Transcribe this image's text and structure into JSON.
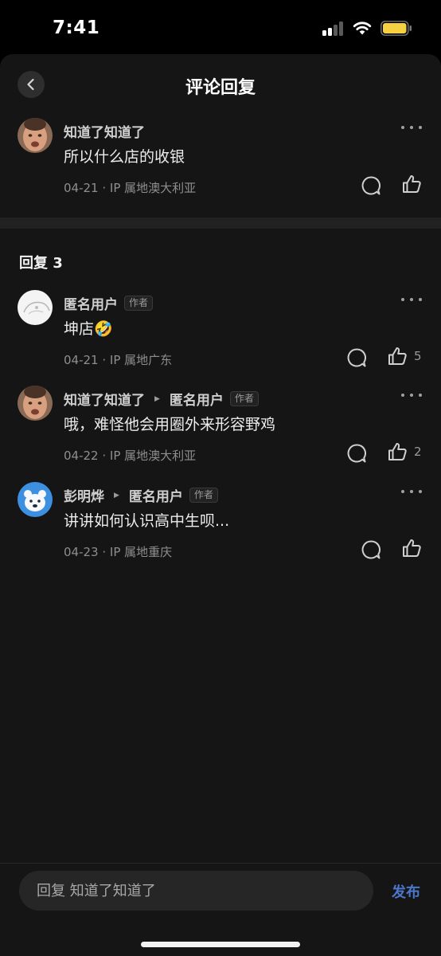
{
  "status_bar": {
    "time": "7:41"
  },
  "header": {
    "title": "评论回复"
  },
  "main_comment": {
    "author": "知道了知道了",
    "text": "所以什么店的收银",
    "meta": "04-21 · IP 属地澳大利亚"
  },
  "replies_section": {
    "title": "回复 3"
  },
  "replies": [
    {
      "author": "匿名用户",
      "badge": "作者",
      "text": "坤店🤣",
      "meta": "04-21 · IP 属地广东",
      "likes": "5"
    },
    {
      "author": "知道了知道了",
      "reply_to": "匿名用户",
      "badge": "作者",
      "text": "哦，难怪他会用圈外来形容野鸡",
      "meta": "04-22 · IP 属地澳大利亚",
      "likes": "2"
    },
    {
      "author": "彭明烨",
      "reply_to": "匿名用户",
      "badge": "作者",
      "text": "讲讲如何认识高中生呗...",
      "meta": "04-23 · IP 属地重庆"
    }
  ],
  "bottom_bar": {
    "input_placeholder": "回复 知道了知道了",
    "publish_label": "发布"
  },
  "icons": {
    "back": "chevron-left-icon",
    "more": "more-horizontal-icon",
    "reply": "speech-bubble-icon",
    "like": "thumbs-up-icon"
  },
  "colors": {
    "background": "#151515",
    "accent": "#4b76c9"
  }
}
